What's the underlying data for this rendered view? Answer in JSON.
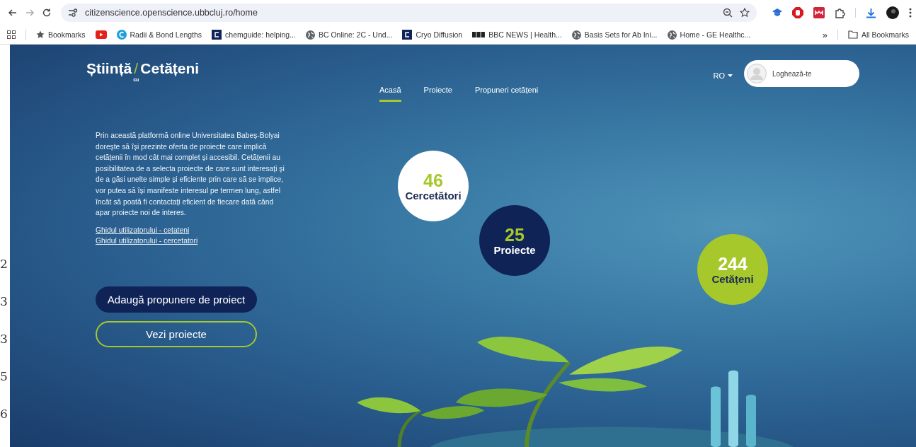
{
  "browser": {
    "url": "citizenscience.openscience.ubbcluj.ro/home",
    "bookmarks": [
      {
        "kind": "star",
        "label": "Bookmarks"
      },
      {
        "kind": "video"
      },
      {
        "kind": "circle",
        "label": "Radii & Bond Lengths"
      },
      {
        "kind": "square",
        "label": "chemguide: helping..."
      },
      {
        "kind": "globe",
        "label": "BC Online: 2C - Und..."
      },
      {
        "kind": "square",
        "label": "Cryo Diffusion"
      },
      {
        "kind": "blocks",
        "label": "BBC NEWS | Health..."
      },
      {
        "kind": "globe",
        "label": "Basis Sets for Ab Ini..."
      },
      {
        "kind": "globe",
        "label": "Home - GE Healthc..."
      }
    ],
    "overflow": "»",
    "all_bookmarks": "All Bookmarks"
  },
  "left_edge_fragments": [
    "2",
    "3",
    "3",
    "5",
    "6"
  ],
  "page": {
    "logo": {
      "first": "Știință",
      "slash": "/",
      "sub": "cu",
      "second": "Cetățeni"
    },
    "nav": [
      {
        "label": "Acasă",
        "selected": true
      },
      {
        "label": "Proiecte",
        "selected": false
      },
      {
        "label": "Propuneri cetățeni",
        "selected": false
      }
    ],
    "language": "RO",
    "login": "Loghează-te",
    "intro": "Prin această platformă online Universitatea Babeș-Bolyai dorește să își prezinte oferta de proiecte care implică cetățenii în mod cât mai complet și accesibil. Cetățenii au posibilitatea de a selecta proiecte de care sunt interesați și de a găsi unelte simple și eficiente prin care să se implice, vor putea să își manifeste interesul pe termen lung, astfel încât să poată fi contactați eficient de fiecare dată când apar proiecte noi de interes.",
    "links": [
      "Ghidul utilizatorului - cetateni",
      "Ghidul utilizatorului - cercetatori"
    ],
    "buttons": [
      {
        "kind": "filled",
        "label": "Adaugă propunere de proiect"
      },
      {
        "kind": "outline",
        "label": "Vezi proiecte"
      }
    ],
    "stats": [
      {
        "kind": "light",
        "number": "46",
        "label": "Cercetători"
      },
      {
        "kind": "dark",
        "number": "25",
        "label": "Proiecte"
      },
      {
        "kind": "accent",
        "number": "244",
        "label": "Cetățeni"
      }
    ]
  }
}
